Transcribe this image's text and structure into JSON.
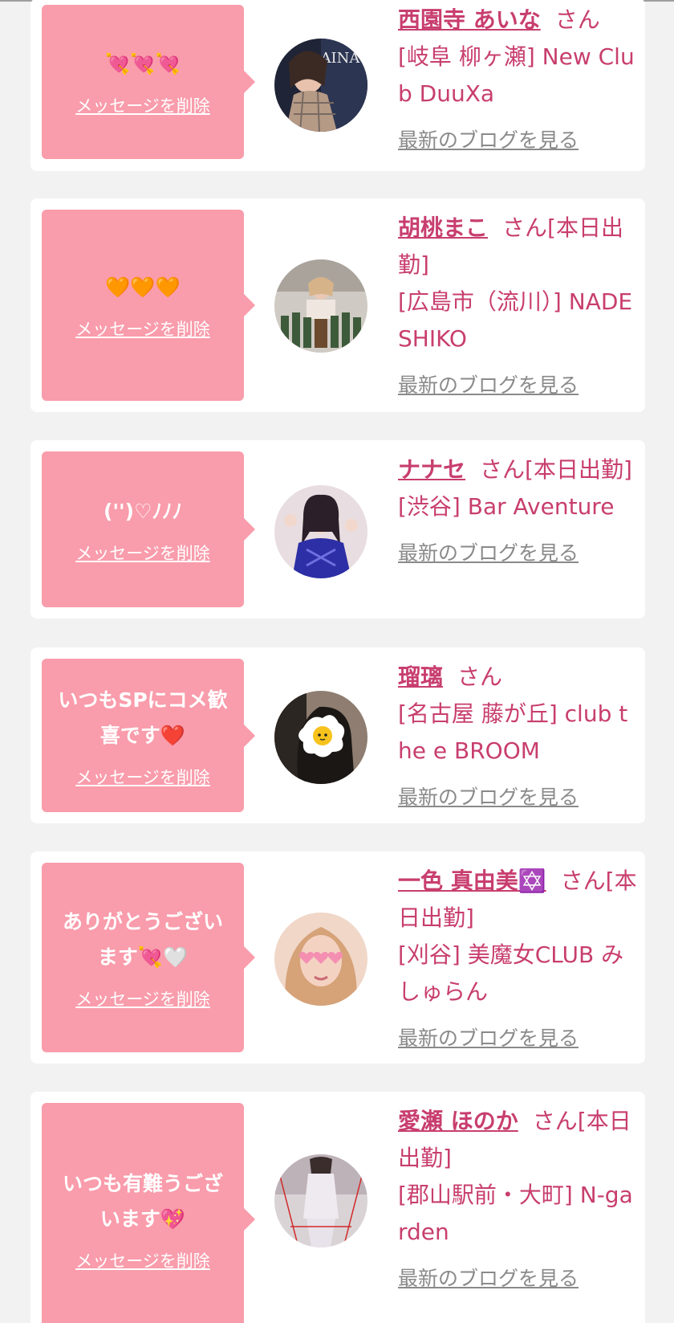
{
  "delete_label": "メッセージを削除",
  "blog_label": "最新のブログを見る",
  "honorific": "さん",
  "colors": {
    "page_bg": "#f2f2f2",
    "card_bg": "#ffffff",
    "bubble_pink": "#f99cab",
    "name_text": "#c83e6e",
    "link_gray": "#8a8a8a"
  },
  "messages": [
    {
      "message": "💘💘💘",
      "name": "西園寺 あいな",
      "status": "",
      "shop": "[岐阜 柳ヶ瀬] New Club DuuXa",
      "avatar_icon": "profile-photo-icon"
    },
    {
      "message": "🧡🧡🧡",
      "name": "胡桃まこ",
      "status": "[本日出勤]",
      "shop": "[広島市（流川）] NADESHIKO",
      "avatar_icon": "profile-photo-icon"
    },
    {
      "message": "('')♡ﾉﾉﾉ",
      "name": "ナナセ",
      "status": "[本日出勤]",
      "shop": "[渋谷] Bar Aventure",
      "avatar_icon": "profile-photo-icon"
    },
    {
      "message": "いつもSPにコメ歓喜です❤️",
      "name": "瑠璃",
      "status": "",
      "shop": "[名古屋 藤が丘] club the e BROOM",
      "avatar_icon": "fried-egg-icon"
    },
    {
      "message": "ありがとうございます💘🤍",
      "name": "一色 真由美✡️",
      "status": "[本日出勤]",
      "shop": "[刈谷] 美魔女CLUB みしゅらん",
      "avatar_icon": "profile-photo-icon"
    },
    {
      "message": "いつも有難うございます💖",
      "name": "愛瀬 ほのか",
      "status": "[本日出勤]",
      "shop": "[郡山駅前・大町] N-garden",
      "avatar_icon": "profile-photo-icon"
    }
  ]
}
